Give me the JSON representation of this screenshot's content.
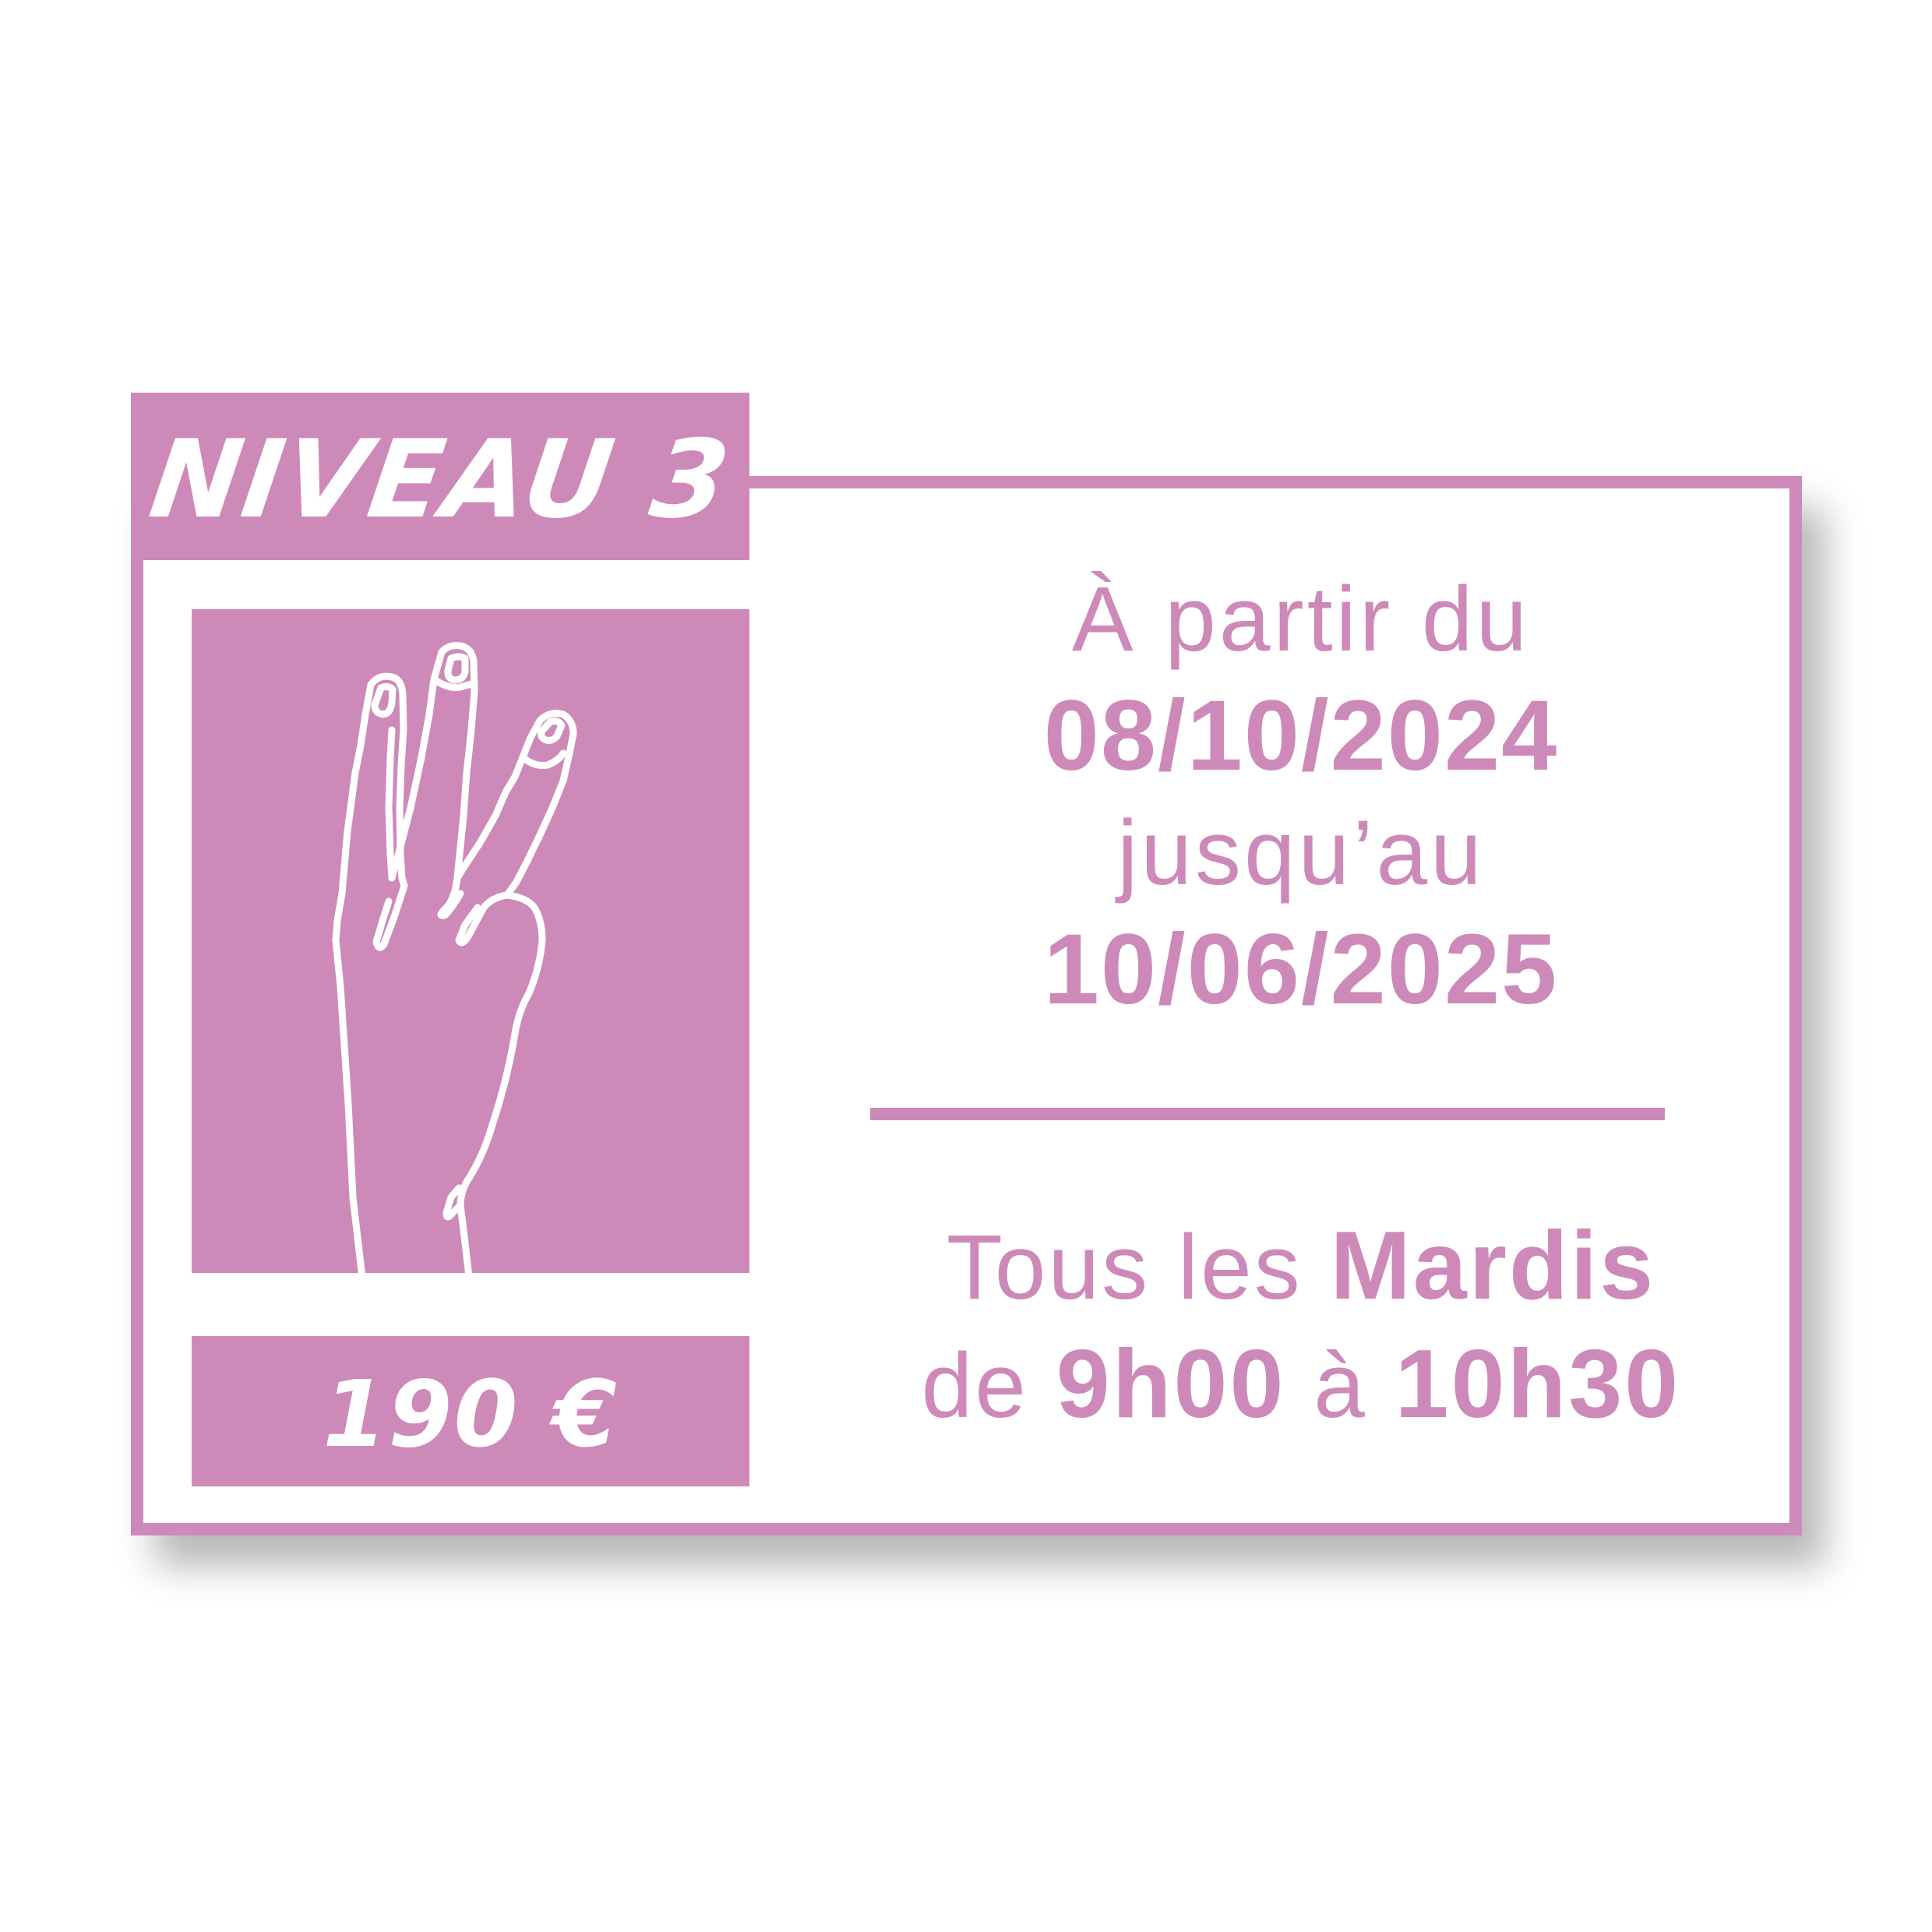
{
  "level": {
    "label": "NIVEAU 3"
  },
  "price": {
    "label": "190 €"
  },
  "illustration": {
    "icon": "three-fingers-hand-icon"
  },
  "dates": {
    "from_label": "À partir du",
    "from_date": "08/10/2024",
    "until_label": "jusqu’au",
    "until_date": "10/06/2025"
  },
  "schedule": {
    "prefix": "Tous les",
    "day": "Mardis",
    "time_prefix": "de",
    "start": "9h00",
    "time_mid": "à",
    "end": "10h30"
  },
  "colors": {
    "accent": "#cd8ab9",
    "background": "#ffffff",
    "text_on_accent": "#ffffff"
  }
}
